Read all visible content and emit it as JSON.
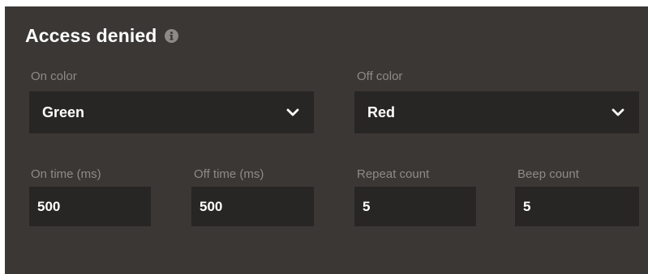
{
  "section": {
    "title": "Access denied",
    "info_icon": "info-icon"
  },
  "on_color": {
    "label": "On color",
    "value": "Green"
  },
  "off_color": {
    "label": "Off color",
    "value": "Red"
  },
  "on_time": {
    "label": "On time (ms)",
    "value": "500"
  },
  "off_time": {
    "label": "Off time (ms)",
    "value": "500"
  },
  "repeat_count": {
    "label": "Repeat count",
    "value": "5"
  },
  "beep_count": {
    "label": "Beep count",
    "value": "5"
  },
  "colors": {
    "panel": "#3a3735",
    "field": "#282624",
    "label": "#8e8a87",
    "text": "#ffffff"
  }
}
